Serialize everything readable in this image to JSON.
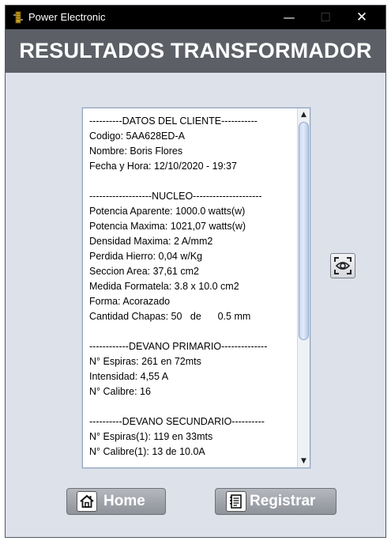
{
  "window": {
    "title": "Power Electronic",
    "minimize_glyph": "—",
    "maximize_glyph": "☐",
    "close_glyph": "✕"
  },
  "header": {
    "title": "RESULTADOS TRANSFORMADOR"
  },
  "report": {
    "lines": [
      "----------DATOS DEL CLIENTE-----------",
      "Codigo: 5AA628ED-A",
      "Nombre: Boris Flores",
      "Fecha y Hora: 12/10/2020 - 19:37",
      "",
      "-------------------NUCLEO---------------------",
      "Potencia Aparente: 1000.0 watts(w)",
      "Potencia Maxima: 1021,07 watts(w)",
      "Densidad Maxima: 2 A/mm2",
      "Perdida Hierro: 0,04 w/Kg",
      "Seccion Area: 37,61 cm2",
      "Medida Formatela: 3.8 x 10.0 cm2",
      "Forma: Acorazado",
      "Cantidad Chapas: 50   de      0.5 mm",
      "",
      "------------DEVANO PRIMARIO--------------",
      "N° Espiras: 261 en 72mts",
      "Intensidad: 4,55 A",
      "N° Calibre: 16",
      "",
      "----------DEVANO SECUNDARIO----------",
      "N° Espiras(1): 119 en 33mts",
      "N° Calibre(1): 13 de 10.0A"
    ]
  },
  "scrollbar": {
    "up_glyph": "▲",
    "down_glyph": "▼"
  },
  "buttons": {
    "home_label": "Home",
    "registrar_label": "Registrar"
  },
  "icons": {
    "app": "transformer-icon",
    "view": "eye-icon",
    "home": "home-icon",
    "registrar": "notebook-icon"
  },
  "colors": {
    "titlebar": "#000000",
    "header_band": "#5c6066",
    "window_bg": "#dce1ea",
    "button_bg": "#9da1a7"
  }
}
